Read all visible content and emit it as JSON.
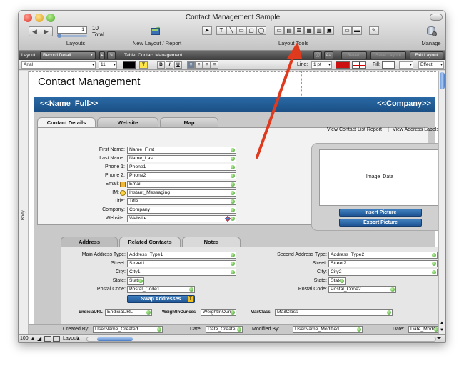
{
  "window": {
    "title": "Contact Management Sample"
  },
  "toolbar": {
    "record_number": "1",
    "total_count": "10",
    "total_label": "Total",
    "layouts_label": "Layouts",
    "new_layout_label": "New Layout / Report",
    "layout_tools_label": "Layout Tools",
    "manage_label": "Manage"
  },
  "layout_bar": {
    "layout_prefix": "Layout:",
    "layout_value": "Record Detail",
    "table_label": "Table: Contact Management",
    "aa_label": "Aa",
    "revert_label": "Revert",
    "save_label": "Save Layout",
    "exit_label": "Exit Layout"
  },
  "format_bar": {
    "font": "Arial",
    "size": "11",
    "bold": "B",
    "italic": "I",
    "underline": "U",
    "text_t": "T",
    "line_label": "Line:",
    "line_value": "1 pt",
    "fill_label": "Fill:",
    "effect_label": "Effect"
  },
  "page": {
    "title": "Contact Management",
    "header_name": "<<Name_Full>>",
    "header_company": "<<Company>>",
    "body_part_label": "Body"
  },
  "top_tabs": [
    {
      "label": "Contact Details"
    },
    {
      "label": "Website"
    },
    {
      "label": "Map"
    }
  ],
  "links": {
    "contact_list": "View Contact List Report",
    "separator": "|",
    "address_labels": "View Address Labels"
  },
  "contact_fields": [
    {
      "label": "First Name:",
      "value": "Name_First"
    },
    {
      "label": "Last Name:",
      "value": "Name_Last"
    },
    {
      "label": "Phone 1:",
      "value": "Phone1"
    },
    {
      "label": "Phone 2:",
      "value": "Phone2"
    },
    {
      "label": "Email:",
      "value": "Email"
    },
    {
      "label": "IM:",
      "value": "Instant_Messaging"
    },
    {
      "label": "Title:",
      "value": "Title"
    },
    {
      "label": "Company:",
      "value": "Company"
    },
    {
      "label": "Website:",
      "value": "Website"
    }
  ],
  "image": {
    "field": "Image_Data",
    "insert_button": "Insert Picture",
    "export_button": "Export Picture"
  },
  "address_tabs": [
    {
      "label": "Address"
    },
    {
      "label": "Related Contacts"
    },
    {
      "label": "Notes"
    }
  ],
  "address_left": [
    {
      "label": "Main Address Type:",
      "value": "Address_Type1"
    },
    {
      "label": "Street:",
      "value": "Street1"
    },
    {
      "label": "City:",
      "value": "City1"
    },
    {
      "label": "State:",
      "value": "State"
    },
    {
      "label": "Postal Code:",
      "value": "Postal_Code1"
    }
  ],
  "address_right": [
    {
      "label": "Second Address Type:",
      "value": "Address_Type2"
    },
    {
      "label": "Street:",
      "value": "Street2"
    },
    {
      "label": "City:",
      "value": "City2"
    },
    {
      "label": "State:",
      "value": "State"
    },
    {
      "label": "Postal Code:",
      "value": "Postal_Code2"
    }
  ],
  "swap_button": "Swap Addresses",
  "extra_fields": [
    {
      "label": "EndiciaURL",
      "value": "EndiciaURL"
    },
    {
      "label": "WeightInOunces",
      "value": "WeightInOun"
    },
    {
      "label": "MailClass",
      "value": "MailClass"
    }
  ],
  "footer_fields": [
    {
      "label": "Created By:",
      "value": "UserName_Created"
    },
    {
      "label": "Date:",
      "value": "Date_Create"
    },
    {
      "label": "Modified By:",
      "value": "UserName_Modified"
    },
    {
      "label": "Date:",
      "value": "Date_Modif"
    }
  ],
  "status": {
    "zoom": "100",
    "mode": "Layout"
  },
  "colors": {
    "header_blue": "#1f5c95",
    "annotation_arrow": "#e03a1e"
  }
}
